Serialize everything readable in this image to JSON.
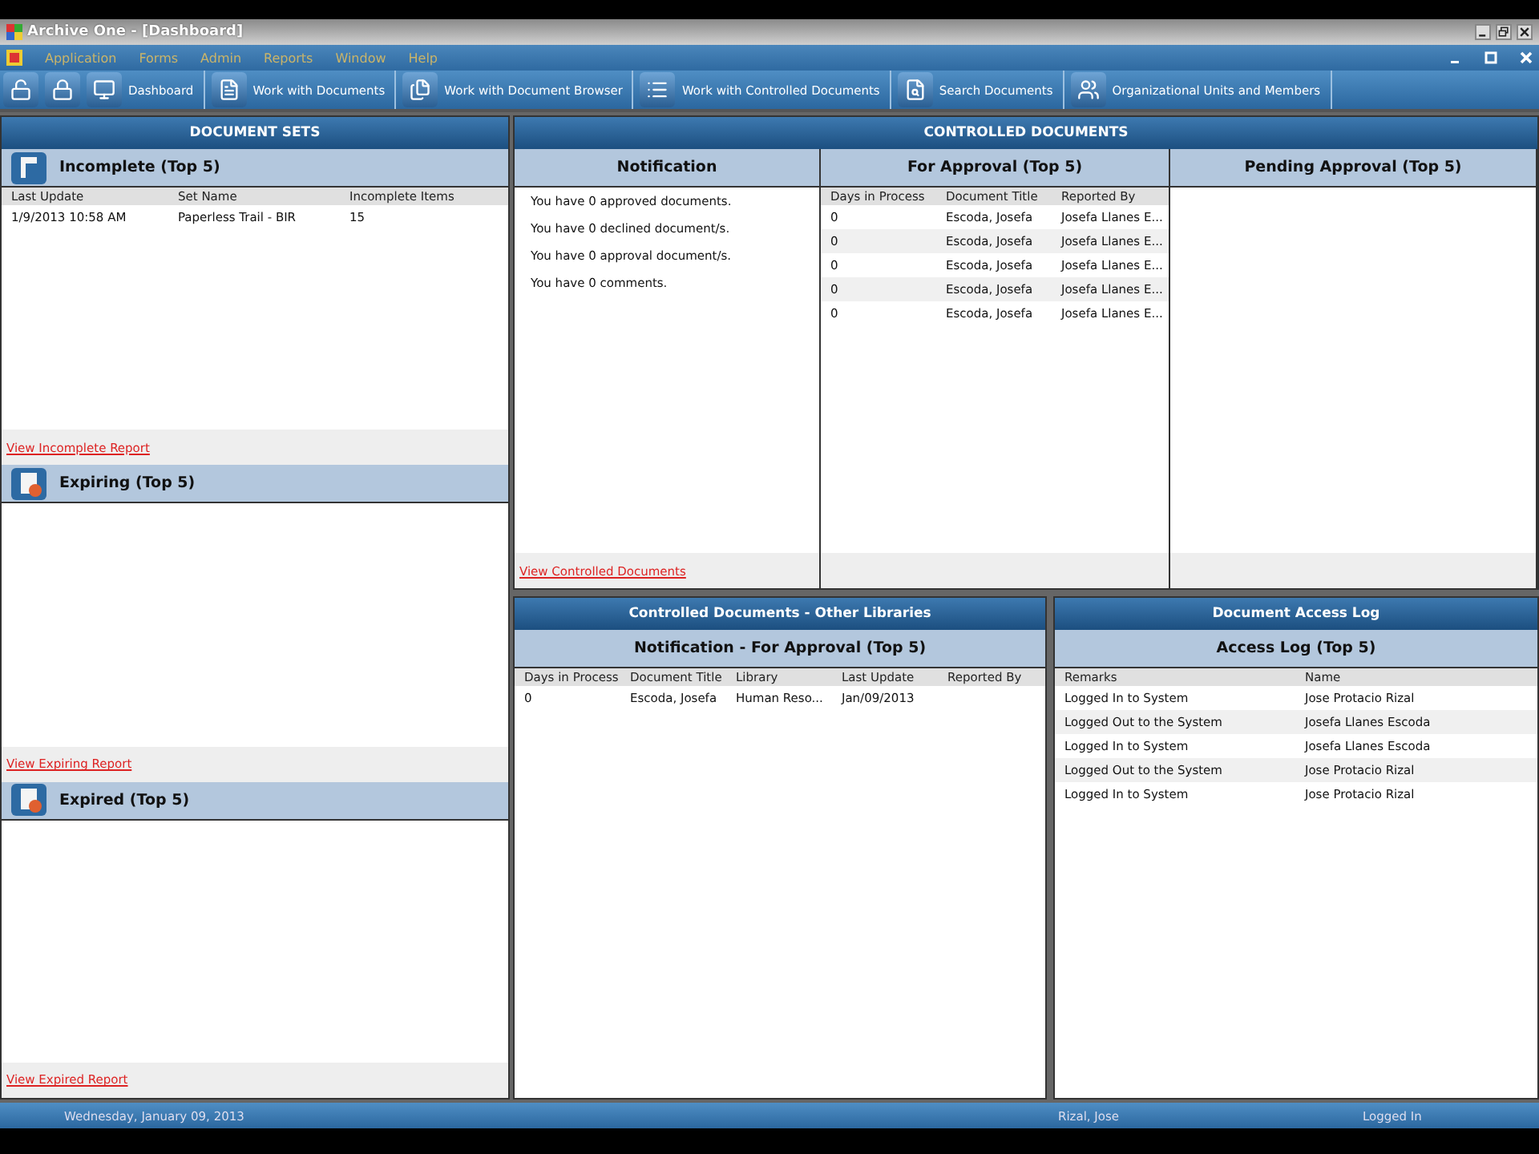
{
  "window": {
    "title": "Archive One - [Dashboard]"
  },
  "menu": [
    "Application",
    "Forms",
    "Admin",
    "Reports",
    "Window",
    "Help"
  ],
  "toolbar": [
    {
      "kind": "unlock"
    },
    {
      "kind": "lock"
    },
    {
      "kind": "dashboard",
      "label": "Dashboard"
    },
    {
      "kind": "documents",
      "label": "Work with Documents"
    },
    {
      "kind": "browser",
      "label": "Work with Document Browser"
    },
    {
      "kind": "controlled",
      "label": "Work with Controlled Documents"
    },
    {
      "kind": "search",
      "label": "Search Documents"
    },
    {
      "kind": "org",
      "label": "Organizational Units and Members"
    }
  ],
  "document_sets": {
    "title": "DOCUMENT SETS",
    "sections": [
      {
        "kind": "incomplete",
        "title": "Incomplete (Top 5)",
        "columns": [
          "Last Update",
          "Set Name",
          "Incomplete Items"
        ],
        "rows": [
          [
            "1/9/2013 10:58 AM",
            "Paperless Trail - BIR",
            "15"
          ]
        ],
        "link": "View Incomplete Report"
      },
      {
        "kind": "expiring",
        "title": "Expiring (Top 5)",
        "link": "View Expiring Report"
      },
      {
        "kind": "expired",
        "title": "Expired (Top 5)",
        "link": "View Expired Report"
      }
    ]
  },
  "controlled_documents": {
    "title": "CONTROLLED DOCUMENTS",
    "notification": {
      "title": "Notification",
      "messages": [
        "You have 0 approved documents.",
        "You have 0 declined document/s.",
        "You have 0 approval document/s.",
        "You have 0 comments."
      ],
      "link": "View Controlled Documents"
    },
    "for_approval": {
      "title": "For Approval (Top 5)",
      "columns": [
        "Days in Process",
        "Document Title",
        "Reported By"
      ],
      "rows": [
        [
          "0",
          "Escoda, Josefa",
          "Josefa Llanes E..."
        ],
        [
          "0",
          "Escoda, Josefa",
          "Josefa Llanes E..."
        ],
        [
          "0",
          "Escoda, Josefa",
          "Josefa Llanes E..."
        ],
        [
          "0",
          "Escoda, Josefa",
          "Josefa Llanes E..."
        ],
        [
          "0",
          "Escoda, Josefa",
          "Josefa Llanes E..."
        ]
      ]
    },
    "pending_approval": {
      "title": "Pending Approval (Top 5)"
    }
  },
  "other_libraries": {
    "title": "Controlled Documents - Other Libraries",
    "subtitle": "Notification - For Approval (Top 5)",
    "columns": [
      "Days in Process",
      "Document Title",
      "Library",
      "Last Update",
      "Reported By"
    ],
    "rows": [
      [
        "0",
        "Escoda, Josefa",
        "Human Reso...",
        "Jan/09/2013"
      ]
    ]
  },
  "access_log": {
    "title": "Document Access Log",
    "subtitle": "Access Log (Top 5)",
    "columns": [
      "Remarks",
      "Name"
    ],
    "rows": [
      [
        "Logged In to System",
        "Jose Protacio Rizal"
      ],
      [
        "Logged Out to the System",
        "Josefa Llanes Escoda"
      ],
      [
        "Logged In to System",
        "Josefa Llanes Escoda"
      ],
      [
        "Logged Out to the System",
        "Jose Protacio Rizal"
      ],
      [
        "Logged In to System",
        "Jose Protacio Rizal"
      ]
    ]
  },
  "status_bar": {
    "date": "Wednesday, January 09, 2013",
    "user": "Rizal, Jose",
    "status": "Logged In"
  }
}
